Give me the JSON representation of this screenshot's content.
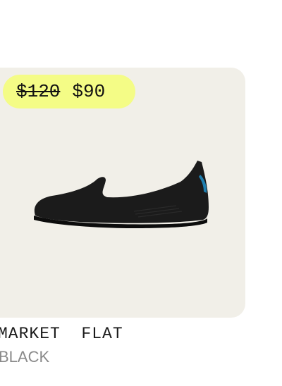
{
  "product": {
    "price": {
      "original": "$120",
      "sale": "$90"
    },
    "name": "MARKET  FLAT",
    "color": "BLACK",
    "image_icon": "black-slip-on-flat-shoe",
    "colors": {
      "card_background": "#f1efe8",
      "price_badge": "#f4fc86",
      "shoe": "#1b1b1b",
      "heel_tab": "#1f7fb0"
    }
  }
}
